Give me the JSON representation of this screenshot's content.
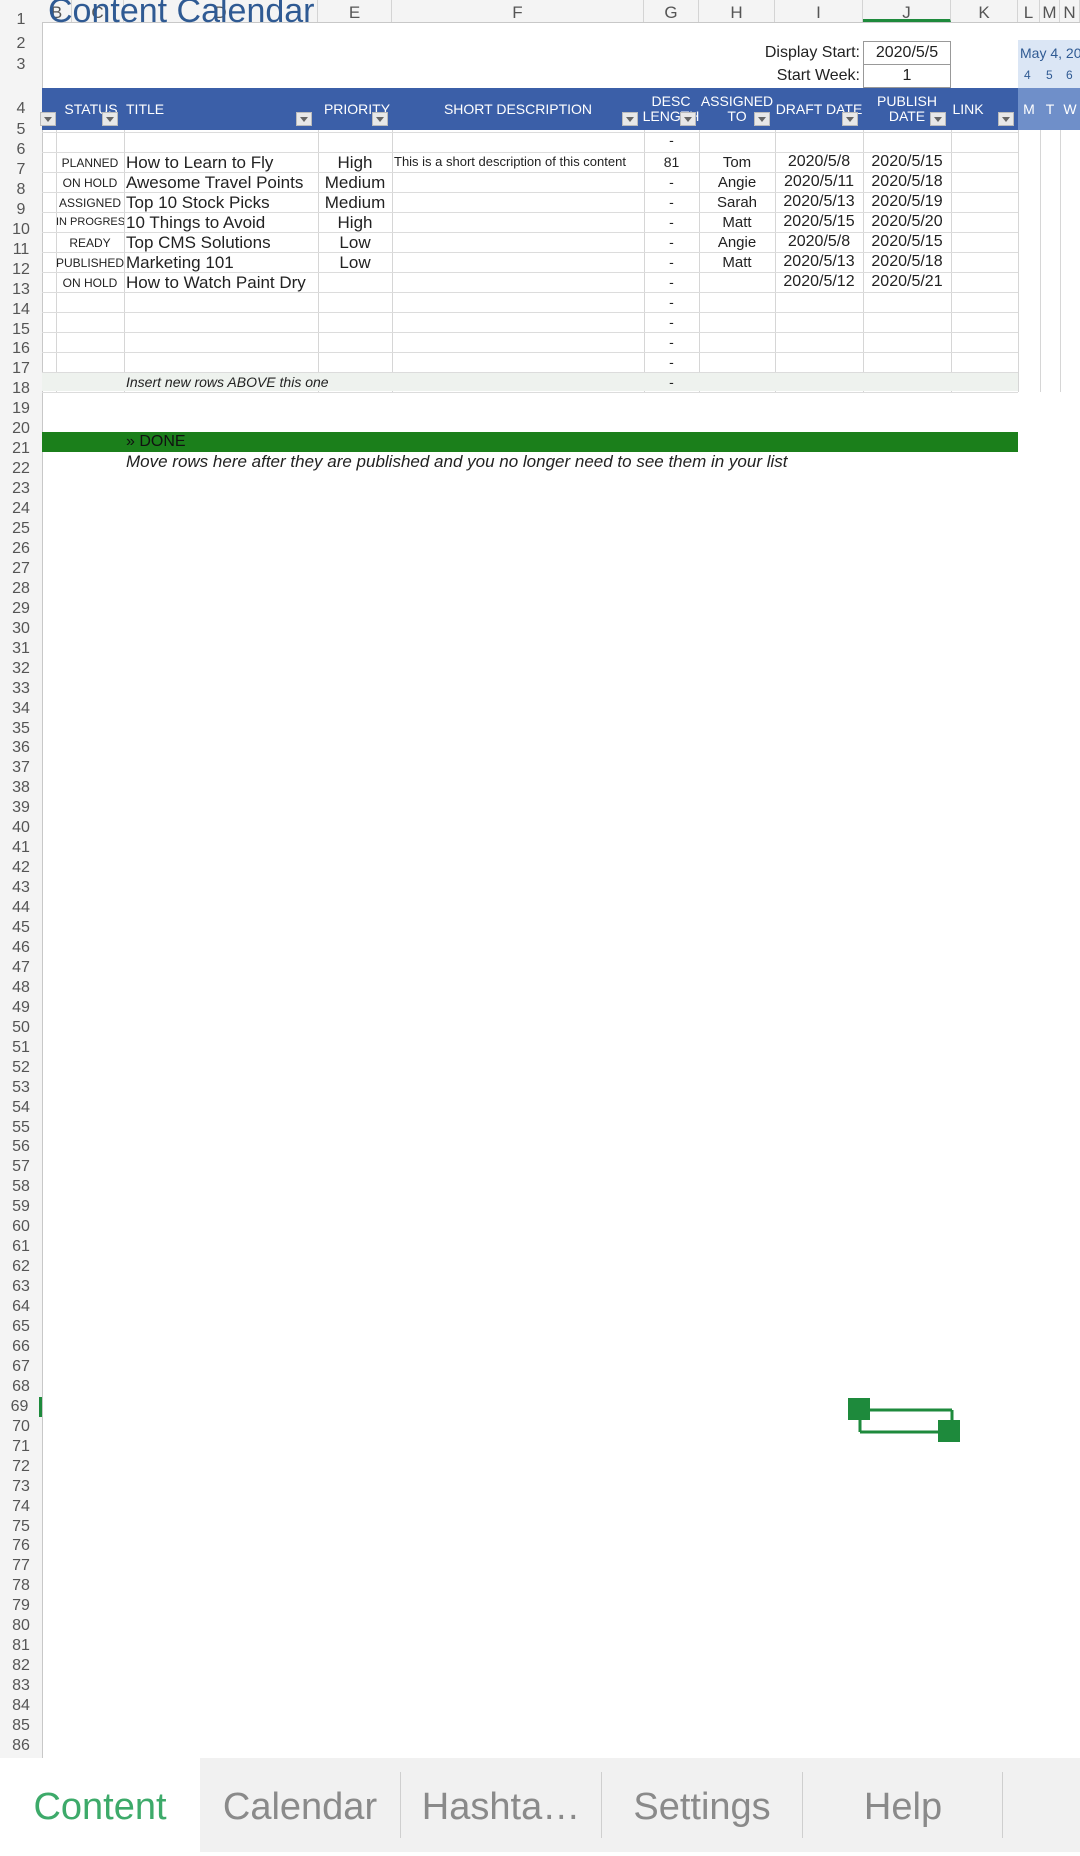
{
  "sheet": {
    "title": "Content Calendar",
    "columns": [
      "B",
      "C",
      "D",
      "E",
      "F",
      "G",
      "H",
      "I",
      "J",
      "K",
      "L",
      "M",
      "N"
    ],
    "display_start_label": "Display Start:",
    "display_start_value": "2020/5/5",
    "start_week_label": "Start Week:",
    "start_week_value": "1",
    "calendar_month": "May 4, 20",
    "calendar_days": [
      "4",
      "5",
      "6"
    ],
    "calendar_weekdays": [
      "M",
      "T",
      "W"
    ],
    "headers": {
      "status": "STATUS",
      "title": "TITLE",
      "priority": "PRIORITY",
      "short_description": "SHORT DESCRIPTION",
      "desc_length": "DESC LENGTH",
      "assigned_to": "ASSIGNED TO",
      "draft_date": "DRAFT DATE",
      "publish_date": "PUBLISH DATE",
      "link": "LINK"
    },
    "rows": [
      {
        "status": "PLANNED",
        "title": "How to Learn to Fly",
        "priority": "High",
        "desc": "This is a short description of this content",
        "len": "81",
        "assigned": "Tom",
        "draft": "2020/5/8",
        "publish": "2020/5/15"
      },
      {
        "status": "ON HOLD",
        "title": "Awesome Travel Points",
        "priority": "Medium",
        "desc": "",
        "len": "-",
        "assigned": "Angie",
        "draft": "2020/5/11",
        "publish": "2020/5/18"
      },
      {
        "status": "ASSIGNED",
        "title": "Top 10 Stock Picks",
        "priority": "Medium",
        "desc": "",
        "len": "-",
        "assigned": "Sarah",
        "draft": "2020/5/13",
        "publish": "2020/5/19"
      },
      {
        "status": "IN PROGRESS",
        "title": "10 Things to Avoid",
        "priority": "High",
        "desc": "",
        "len": "-",
        "assigned": "Matt",
        "draft": "2020/5/15",
        "publish": "2020/5/20"
      },
      {
        "status": "READY",
        "title": "Top CMS Solutions",
        "priority": "Low",
        "desc": "",
        "len": "-",
        "assigned": "Angie",
        "draft": "2020/5/8",
        "publish": "2020/5/15"
      },
      {
        "status": "PUBLISHED",
        "title": "Marketing 101",
        "priority": "Low",
        "desc": "",
        "len": "-",
        "assigned": "Matt",
        "draft": "2020/5/13",
        "publish": "2020/5/18"
      },
      {
        "status": "ON HOLD",
        "title": "How to Watch Paint Dry",
        "priority": "",
        "desc": "",
        "len": "-",
        "assigned": "",
        "draft": "2020/5/12",
        "publish": "2020/5/21"
      }
    ],
    "row5_len": "-",
    "empty_len": "-",
    "insert_note": "Insert new rows ABOVE this one",
    "done_label": "» DONE",
    "done_note": "Move rows here after they are published and you no longer need to see them in your list"
  },
  "tabs": [
    "Content",
    "Calendar",
    "Hashta…",
    "Settings",
    "Help"
  ],
  "colors": {
    "header_blue": "#3b5fa8",
    "done_green": "#1b7f1b",
    "active_tab": "#3daa6a",
    "title_blue": "#2f5a93"
  }
}
